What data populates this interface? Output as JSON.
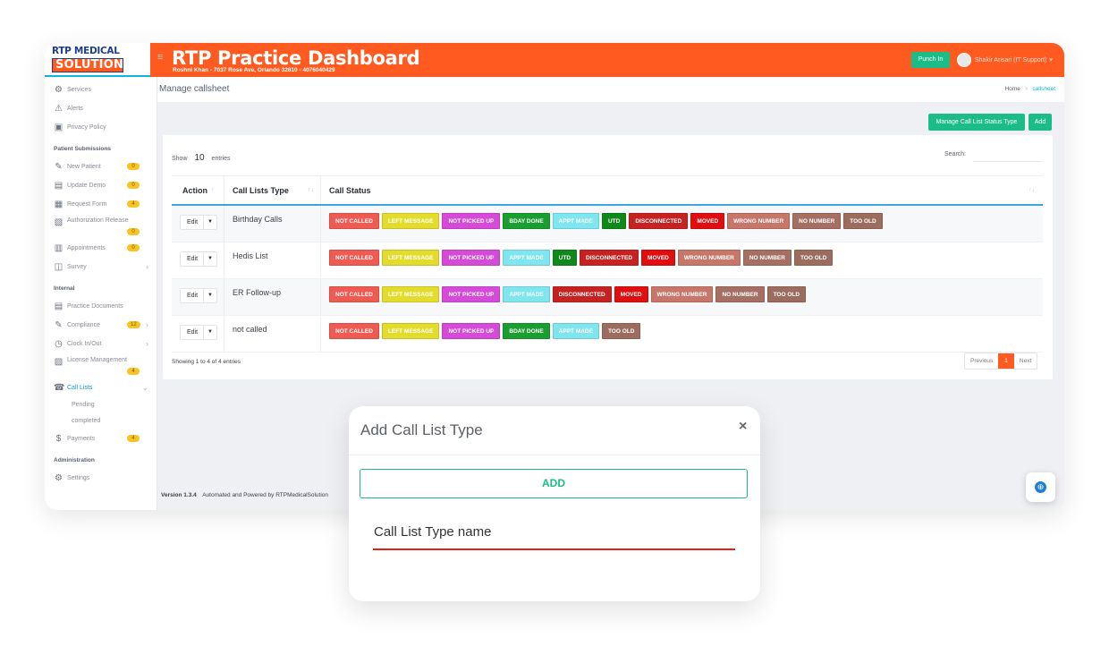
{
  "logo": {
    "top": "RTP MEDICAL",
    "bottom": "SOLUTION"
  },
  "header": {
    "title": "RTP Practice Dashboard",
    "subtitle": "Roshni Khan - 7037 Rose Ave, Orlando 32810 - 4076040429",
    "punch_label": "Punch In",
    "user_name": "Shakir Ansari (IT Support)"
  },
  "sidebar": {
    "top_items": [
      {
        "label": "Services",
        "icon": "services-icon"
      },
      {
        "label": "Alerts",
        "icon": "alerts-icon"
      },
      {
        "label": "Privacy Policy",
        "icon": "privacy-icon"
      }
    ],
    "section_patient": "Patient Submissions",
    "patient_items": [
      {
        "label": "New Patient",
        "badge": "0"
      },
      {
        "label": "Update Demo",
        "badge": "0"
      },
      {
        "label": "Request Form",
        "badge": "4"
      },
      {
        "label": "Authorization Release",
        "badge": "0"
      },
      {
        "label": "Appointments",
        "badge": "0"
      },
      {
        "label": "Survey"
      }
    ],
    "section_internal": "Internal",
    "internal_items": [
      {
        "label": "Practice Documents"
      },
      {
        "label": "Compliance",
        "badge": "12"
      },
      {
        "label": "Clock In/Out"
      },
      {
        "label": "License Management",
        "badge": "4"
      },
      {
        "label": "Call Lists"
      }
    ],
    "call_list_subs": [
      "Pending",
      "completed"
    ],
    "payments": {
      "label": "Payments",
      "badge": "4"
    },
    "section_admin": "Administration",
    "settings_label": "Settings"
  },
  "page": {
    "title": "Manage callsheet",
    "breadcrumb_home": "Home",
    "breadcrumb_sep": ">",
    "breadcrumb_current": "callsheet",
    "manage_status_btn": "Manage Call List Status Type",
    "add_btn": "Add"
  },
  "table": {
    "show_label": "Show",
    "show_value": "10",
    "entries_label": "entries",
    "search_label": "Search:",
    "columns": [
      "Action",
      "Call Lists Type",
      "Call Status"
    ],
    "edit_label": "Edit",
    "rows": [
      {
        "type": "Birthday Calls",
        "statuses": [
          "NOT CALLED",
          "LEFT MESSAGE",
          "NOT PICKED UP",
          "BDAY DONE",
          "APPT MADE",
          "UTD",
          "DISCONNECTED",
          "MOVED",
          "WRONG NUMBER",
          "NO NUMBER",
          "TOO OLD"
        ]
      },
      {
        "type": "Hedis List",
        "statuses": [
          "NOT CALLED",
          "LEFT MESSAGE",
          "NOT PICKED UP",
          "APPT MADE",
          "UTD",
          "DISCONNECTED",
          "MOVED",
          "WRONG NUMBER",
          "NO NUMBER",
          "TOO OLD"
        ]
      },
      {
        "type": "ER Follow-up",
        "statuses": [
          "NOT CALLED",
          "LEFT MESSAGE",
          "NOT PICKED UP",
          "APPT MADE",
          "DISCONNECTED",
          "MOVED",
          "WRONG NUMBER",
          "NO NUMBER",
          "TOO OLD"
        ]
      },
      {
        "type": "not called",
        "statuses": [
          "NOT CALLED",
          "LEFT MESSAGE",
          "NOT PICKED UP",
          "BDAY DONE",
          "APPT MADE",
          "TOO OLD"
        ]
      }
    ],
    "showing_info": "Showing 1 to 4 of 4 entries",
    "pager": {
      "prev": "Previous",
      "page": "1",
      "next": "Next"
    }
  },
  "status_colors": {
    "NOT CALLED": "#ef5b52",
    "LEFT MESSAGE": "#e3dc2c",
    "NOT PICKED UP": "#d64ad8",
    "BDAY DONE": "#1a9e30",
    "APPT MADE": "#7fe6f0",
    "UTD": "#0f8a1a",
    "DISCONNECTED": "#c62222",
    "MOVED": "#e00e0e",
    "WRONG NUMBER": "#c7766a",
    "NO NUMBER": "#a56f64",
    "TOO OLD": "#9c6d5e"
  },
  "footer": {
    "version": "Version 1.3.4",
    "powered": "Automated and Powered by RTPMedicalSolution"
  },
  "modal": {
    "title": "Add Call List Type",
    "close": "×",
    "add_label": "ADD",
    "input_label": "Call List Type name"
  }
}
